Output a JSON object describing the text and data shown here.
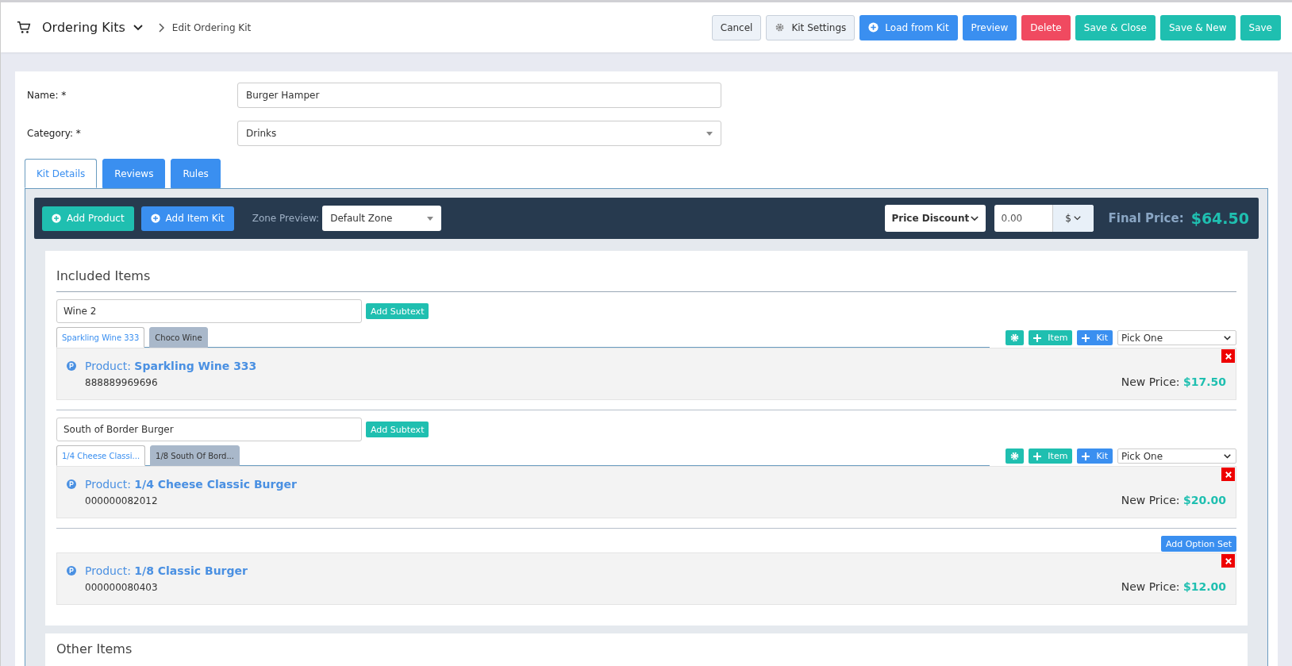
{
  "header": {
    "title": "Ordering Kits",
    "breadcrumb": "Edit Ordering Kit",
    "buttons": [
      {
        "label": "Cancel",
        "kind": "plain"
      },
      {
        "label": "Kit Settings",
        "kind": "settings"
      },
      {
        "label": "Load from Kit",
        "kind": "load"
      },
      {
        "label": "Preview",
        "kind": "primary"
      },
      {
        "label": "Delete",
        "kind": "danger"
      },
      {
        "label": "Save & Close",
        "kind": "success"
      },
      {
        "label": "Save & New",
        "kind": "success"
      },
      {
        "label": "Save",
        "kind": "success"
      }
    ]
  },
  "form": [
    {
      "label": "Name: *",
      "value": "Burger Hamper",
      "kind": "text"
    },
    {
      "label": "Category: *",
      "value": "Drinks",
      "kind": "select"
    }
  ],
  "tabs": [
    {
      "label": "Kit Details",
      "selected": true
    },
    {
      "label": "Reviews",
      "selected": false
    },
    {
      "label": "Rules",
      "selected": false
    }
  ],
  "toolbar": {
    "buttons": [
      {
        "label": "Add Product",
        "kind": "success"
      },
      {
        "label": "Add Item Kit",
        "kind": "primary"
      }
    ],
    "zone_label": "Zone Preview:",
    "zone_value": "Default Zone",
    "discount_type": "Price Discount",
    "discount_value": "0.00",
    "unit": "$",
    "final_label": "Final Price:",
    "final_price": "$64.50"
  },
  "included": {
    "title": "Included Items",
    "groups": [
      {
        "kind": "option",
        "name": "Wine 2",
        "subtext_button": "Add Subtext",
        "option_tabs": [
          {
            "label": "Sparkling Wine 333",
            "selected": true
          },
          {
            "label": "Choco Wine",
            "selected": false
          }
        ],
        "item_button": "Item",
        "kit_button": "Kit",
        "pick": "Pick One",
        "product": {
          "text": "Product: **Sparkling Wine 333**",
          "sku": "888889969696",
          "price": "New Price: **$17.50**"
        }
      },
      {
        "kind": "option",
        "name": "South of Border Burger",
        "subtext_button": "Add Subtext",
        "option_tabs": [
          {
            "label": "1/4 Cheese Classi...",
            "selected": true
          },
          {
            "label": "1/8 South Of Bord...",
            "selected": false
          }
        ],
        "item_button": "Item",
        "kit_button": "Kit",
        "pick": "Pick One",
        "product": {
          "text": "Product: **1/4 Cheese Classic Burger**",
          "sku": "000000082012",
          "price": "New Price: **$20.00**"
        }
      },
      {
        "kind": "single",
        "option_set_button": "Add Option Set",
        "product": {
          "text": "Product: **1/8 Classic Burger**",
          "sku": "000000080403",
          "price": "New Price: **$12.00**"
        }
      }
    ]
  },
  "other": {
    "title": "Other Items"
  }
}
